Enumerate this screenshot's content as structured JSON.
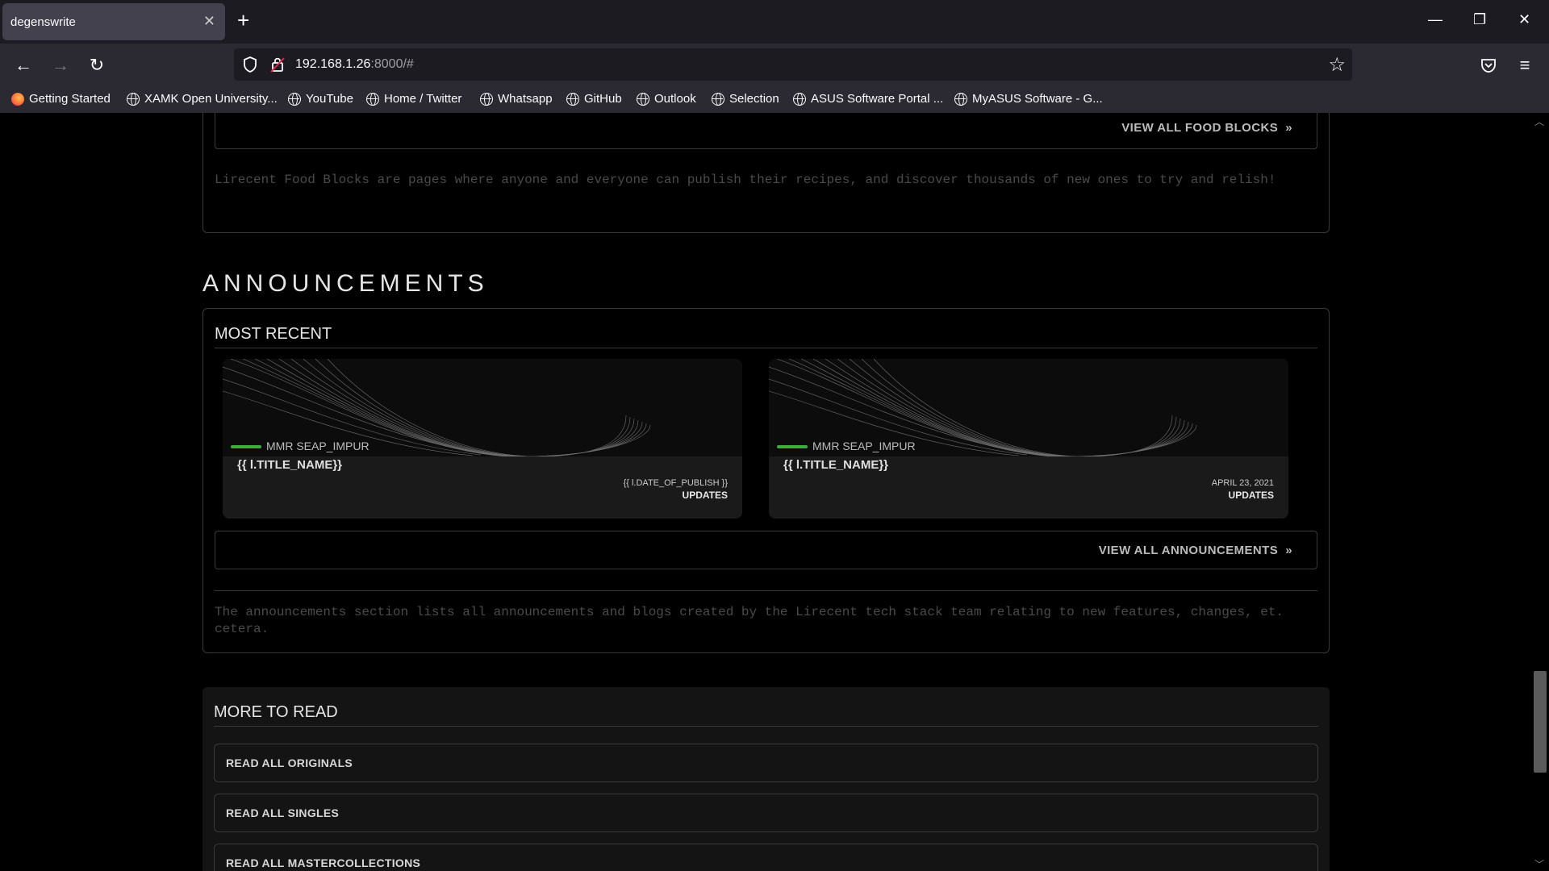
{
  "browser": {
    "tab_title": "degenswrite",
    "url_host": "192.168.1.26",
    "url_rest": ":8000/#",
    "bookmarks": [
      {
        "label": "Getting Started",
        "icon": "firefox-icon"
      },
      {
        "label": "XAMK Open University...",
        "icon": "globe-icon"
      },
      {
        "label": "YouTube",
        "icon": "globe-icon"
      },
      {
        "label": "Home / Twitter",
        "icon": "globe-icon"
      },
      {
        "label": "Whatsapp",
        "icon": "globe-icon"
      },
      {
        "label": "GitHub",
        "icon": "globe-icon"
      },
      {
        "label": "Outlook",
        "icon": "globe-icon"
      },
      {
        "label": "Selection",
        "icon": "globe-icon"
      },
      {
        "label": "ASUS Software Portal ...",
        "icon": "globe-icon"
      },
      {
        "label": "MyASUS Software - G...",
        "icon": "globe-icon"
      }
    ]
  },
  "food_blocks": {
    "view_all_label": "VIEW ALL FOOD BLOCKS",
    "description": "Lirecent Food Blocks are pages where anyone and everyone can publish their recipes, and discover thousands of new ones to try and relish!"
  },
  "announcements": {
    "heading": "ANNOUNCEMENTS",
    "subheading": "MOST RECENT",
    "cards": [
      {
        "tag": "MMR SEAP_IMPUR",
        "title": "{{ l.TITLE_NAME}}",
        "date": "{{ l.DATE_OF_PUBLISH }}",
        "category": "UPDATES"
      },
      {
        "tag": "MMR SEAP_IMPUR",
        "title": "{{ l.TITLE_NAME}}",
        "date": "APRIL 23, 2021",
        "category": "UPDATES"
      }
    ],
    "view_all_label": "VIEW ALL ANNOUNCEMENTS",
    "description": "The announcements section lists all announcements and blogs created by the Lirecent tech stack team relating to new features, changes, et. cetera."
  },
  "more_to_read": {
    "heading": "MORE TO READ",
    "buttons": [
      "READ ALL ORIGINALS",
      "READ ALL SINGLES",
      "READ ALL MASTERCOLLECTIONS"
    ]
  },
  "colors": {
    "tag_accent": "#3cae3c",
    "page_bg": "#000000",
    "panel_border": "#3a3a3a"
  },
  "scroll_position": 0.82
}
